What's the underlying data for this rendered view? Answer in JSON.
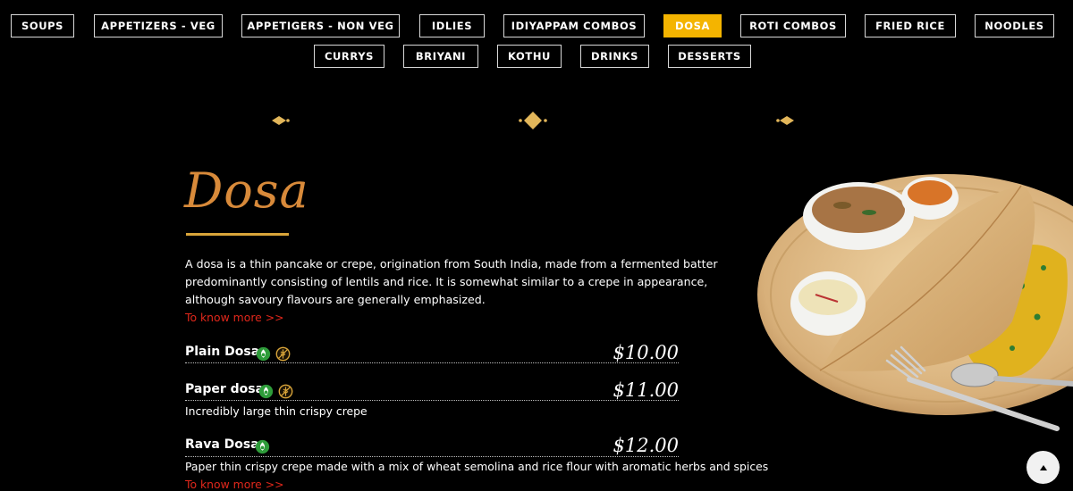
{
  "nav": {
    "tabs": [
      {
        "label": "SOUPS"
      },
      {
        "label": "APPETIZERS - VEG"
      },
      {
        "label": "APPETIGERS - NON VEG"
      },
      {
        "label": "IDLIES"
      },
      {
        "label": "IDIYAPPAM COMBOS"
      },
      {
        "label": "DOSA",
        "active": true
      },
      {
        "label": "ROTI COMBOS"
      },
      {
        "label": "FRIED RICE"
      },
      {
        "label": "NOODLES"
      },
      {
        "label": "CURRYS"
      },
      {
        "label": "BRIYANI"
      },
      {
        "label": "KOTHU"
      },
      {
        "label": "DRINKS"
      },
      {
        "label": "DESSERTS"
      }
    ]
  },
  "section": {
    "title": "Dosa",
    "description": "A dosa is a thin pancake or crepe, origination from South India, made from a fermented batter predominantly consisting of lentils and rice. It is somewhat similar to a crepe in appearance, although savoury flavours are generally emphasized.",
    "more_link": "To know more >>"
  },
  "menu_items": [
    {
      "name": "Plain Dosa",
      "price": "$10.00",
      "icons": [
        "veg-icon",
        "gluten-free-icon"
      ],
      "description": ""
    },
    {
      "name": "Paper dosa",
      "price": "$11.00",
      "icons": [
        "veg-icon",
        "gluten-free-icon"
      ],
      "description": "Incredibly large thin crispy crepe"
    },
    {
      "name": "Rava Dosa",
      "price": "$12.00",
      "icons": [
        "veg-icon"
      ],
      "description": "Paper thin crispy crepe made with a mix of wheat semolina and rice flour with aromatic herbs and spices",
      "more_link": "To know more >>"
    }
  ],
  "colors": {
    "accent": "#f4b400",
    "title": "#d88a3a",
    "link": "#e0271b",
    "veg": "#2e9c3a"
  },
  "scroll_top_icon": "caret-up-icon"
}
